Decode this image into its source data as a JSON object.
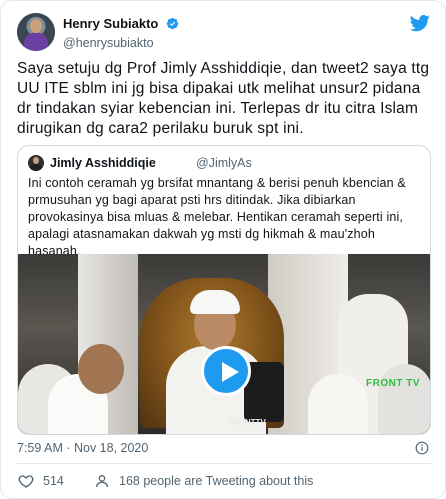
{
  "author": {
    "display_name": "Henry Subiakto",
    "handle": "@henrysubiakto",
    "verified": true
  },
  "tweet": {
    "text": "Saya setuju dg Prof Jimly Asshiddiqie, dan tweet2 saya ttg UU ITE sblm ini jg bisa dipakai utk melihat unsur2 pidana dr tindakan syiar kebencian ini. Terlepas dr itu citra Islam dirugikan dg cara2 perilaku buruk spt ini."
  },
  "quote": {
    "display_name": "Jimly Asshiddiqie",
    "handle": "@JimlyAs",
    "text": "Ini contoh ceramah yg brsifat mnantang & berisi penuh kbencian & prmusuhan yg bagi aparat psti hrs ditindak. Jika dibiarkan provokasinya bisa mluas & melebar. Hentikan ceramah seperti ini, apalagi atasnamakan dakwah yg msti dg hikmah & mau'zhoh hasanah.",
    "media": {
      "type": "video",
      "watermark": "FRONT TV",
      "watermark_bottom": "FRONTTV"
    }
  },
  "meta": {
    "timestamp": "7:59 AM · Nov 18, 2020"
  },
  "actions": {
    "like_count": "514",
    "people_text": "168 people are Tweeting about this"
  },
  "colors": {
    "accent": "#1d9bf0",
    "text_primary": "#0f1419",
    "text_secondary": "#536471",
    "border": "#e1e8ed"
  },
  "icons": {
    "verified": "verified-badge-icon",
    "brand": "twitter-bird-icon",
    "play": "play-icon",
    "info": "info-icon",
    "like": "heart-icon",
    "people": "person-icon"
  }
}
